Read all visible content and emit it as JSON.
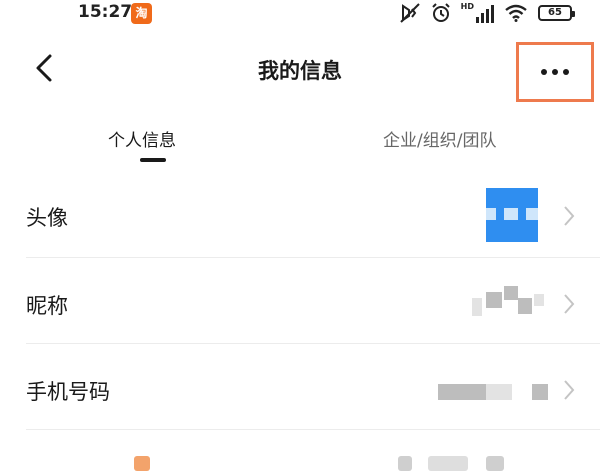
{
  "status_bar": {
    "time": "15:27",
    "app_badge": "淘",
    "network_label": "HD",
    "battery_level": "65"
  },
  "header": {
    "title": "我的信息"
  },
  "tabs": [
    {
      "label": "个人信息",
      "active": true
    },
    {
      "label": "企业/组织/团队",
      "active": false
    }
  ],
  "rows": [
    {
      "label": "头像"
    },
    {
      "label": "昵称"
    },
    {
      "label": "手机号码"
    }
  ],
  "colors": {
    "highlight_border": "#ee7a4d",
    "avatar_blue": "#2f8ef0",
    "app_badge": "#f06a1a"
  }
}
